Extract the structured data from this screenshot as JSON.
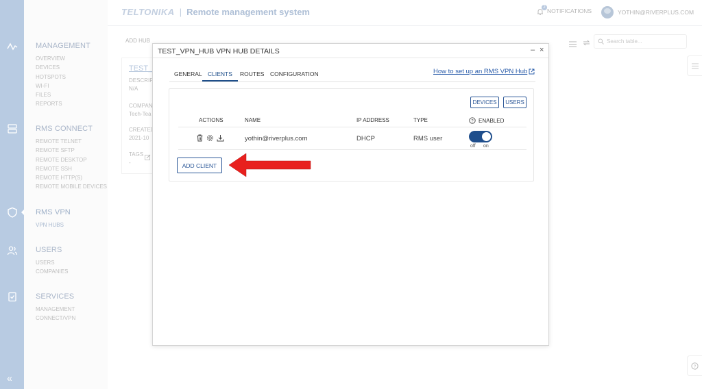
{
  "header": {
    "brand": "TELTONIKA",
    "separator": "|",
    "title": "Remote management system",
    "notifications_label": "NOTIFICATIONS",
    "notifications_count": "2",
    "user_email": "YOTHIN@RIVERPLUS.COM"
  },
  "nav": {
    "management": {
      "heading": "MANAGEMENT",
      "items": [
        "OVERVIEW",
        "DEVICES",
        "HOTSPOTS",
        "WI-FI",
        "FILES",
        "REPORTS"
      ]
    },
    "rms_connect": {
      "heading": "RMS CONNECT",
      "items": [
        "REMOTE TELNET",
        "REMOTE SFTP",
        "REMOTE DESKTOP",
        "REMOTE SSH",
        "REMOTE HTTP(S)",
        "REMOTE MOBILE DEVICES"
      ]
    },
    "rms_vpn": {
      "heading": "RMS VPN",
      "items": [
        "VPN HUBS"
      ]
    },
    "users": {
      "heading": "USERS",
      "items": [
        "USERS",
        "COMPANIES"
      ]
    },
    "services": {
      "heading": "SERVICES",
      "items": [
        "MANAGEMENT",
        "CONNECT/VPN"
      ]
    }
  },
  "background": {
    "add_hub": "ADD HUB",
    "hub_link": "TEST_VI",
    "description_label": "DESCRIPT",
    "description_value": "N/A",
    "company_label": "COMPANY",
    "company_value": "Tech-Tea",
    "created_label": "CREATED",
    "created_value": "2021-10",
    "tags_label": "TAGS",
    "tags_value": "-",
    "search_placeholder": "Search table..."
  },
  "dialog": {
    "title": "TEST_VPN_HUB VPN HUB DETAILS",
    "minimize": "–",
    "close": "×",
    "tabs": [
      "GENERAL",
      "CLIENTS",
      "ROUTES",
      "CONFIGURATION"
    ],
    "active_tab": "CLIENTS",
    "help_link": "How to set up an RMS VPN Hub",
    "filter_buttons": {
      "devices": "DEVICES",
      "users": "USERS"
    },
    "columns": {
      "actions": "ACTIONS",
      "name": "NAME",
      "ip": "IP ADDRESS",
      "type": "TYPE",
      "enabled": "ENABLED"
    },
    "rows": [
      {
        "name": "yothin@riverplus.com",
        "ip": "DHCP",
        "type": "RMS user",
        "enabled": true,
        "off_label": "off",
        "on_label": "on"
      }
    ],
    "add_client": "ADD CLIENT"
  },
  "colors": {
    "accent": "#1f4e8c",
    "arrow": "#e8201e",
    "rail": "#b8cbe2"
  },
  "icons": [
    "activity-icon",
    "server-icon",
    "shield-icon",
    "users-icon",
    "clipboard-check-icon",
    "bell-icon",
    "trash-icon",
    "gear-icon",
    "download-icon",
    "help-circle-icon",
    "external-link-icon",
    "search-icon",
    "list-icon",
    "refresh-icon",
    "edit-icon",
    "double-chevron-left-icon"
  ]
}
